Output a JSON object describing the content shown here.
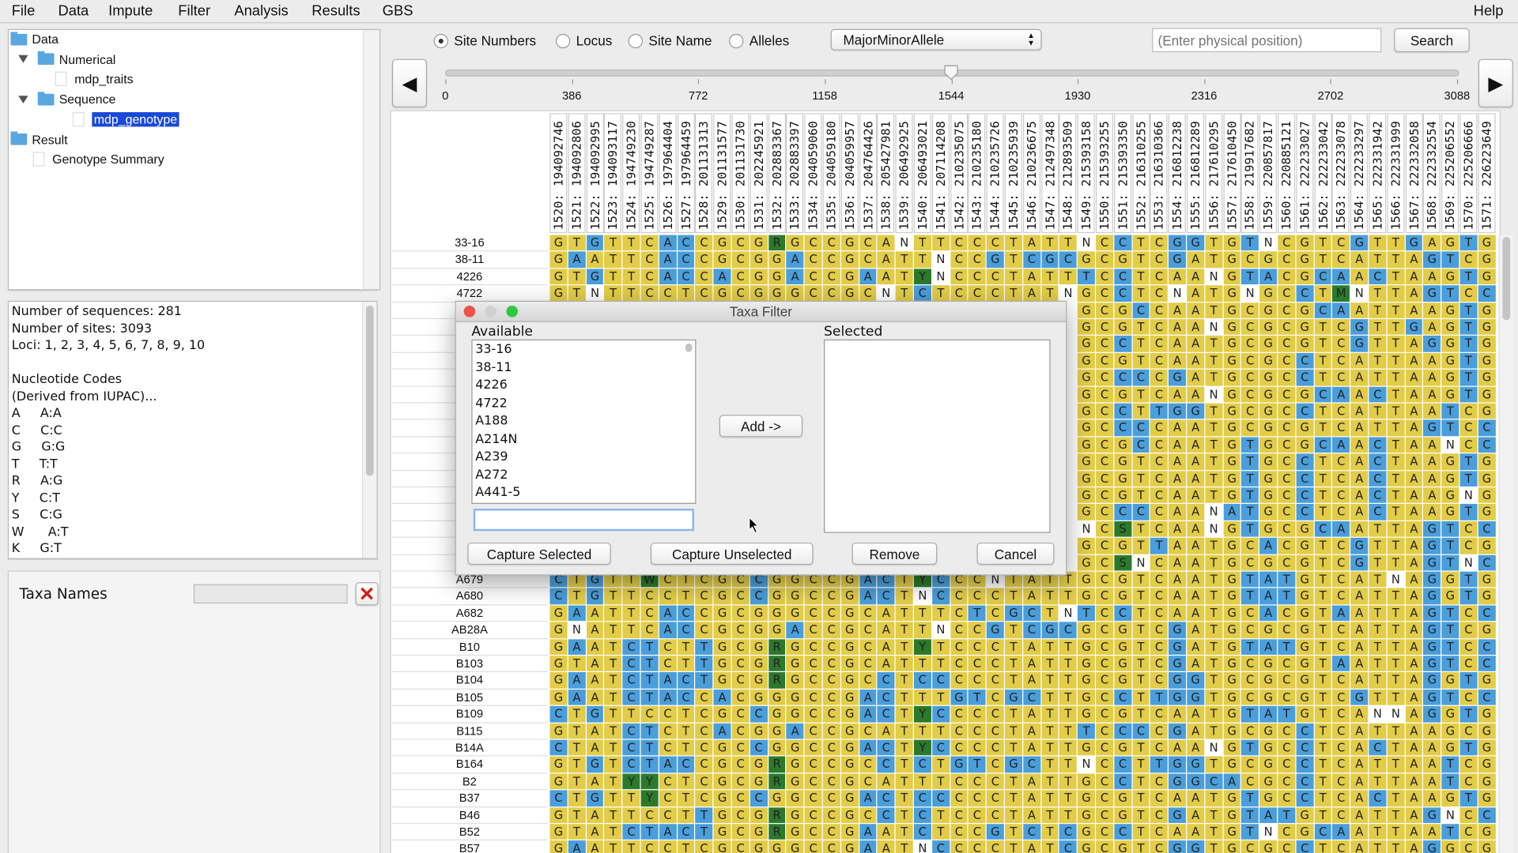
{
  "menu": {
    "items": [
      "File",
      "Data",
      "Impute",
      "Filter",
      "Analysis",
      "Results",
      "GBS"
    ],
    "help": "Help"
  },
  "tree": [
    {
      "label": "Data",
      "type": "folder",
      "expand": false,
      "selected": false
    },
    {
      "label": "Numerical",
      "type": "folder",
      "expand": true,
      "selected": false
    },
    {
      "label": "mdp_traits",
      "type": "doc",
      "expand": false,
      "selected": false
    },
    {
      "label": "Sequence",
      "type": "folder",
      "expand": true,
      "selected": false
    },
    {
      "label": "mdp_genotype",
      "type": "doc",
      "expand": false,
      "selected": true
    },
    {
      "label": "Result",
      "type": "folder",
      "expand": false,
      "selected": false
    },
    {
      "label": "Genotype Summary",
      "type": "doc",
      "expand": false,
      "selected": false
    }
  ],
  "info": [
    "Number of sequences: 281",
    "Number of sites: 3093",
    "Loci: 1, 2, 3, 4, 5, 6, 7, 8, 9, 10",
    "",
    "Nucleotide Codes",
    "(Derived from IUPAC)...",
    "A     A:A",
    "C     C:C",
    "G     G:G",
    "T     T:T",
    "R     A:G",
    "Y     C:T",
    "S     C:G",
    "W      A:T",
    "K     G:T"
  ],
  "taxa_names": {
    "label": "Taxa Names",
    "value": "",
    "clear_icon": "red-x-icon"
  },
  "view_options": {
    "radios": [
      {
        "label": "Site Numbers",
        "checked": true
      },
      {
        "label": "Locus",
        "checked": false
      },
      {
        "label": "Site Name",
        "checked": false
      },
      {
        "label": "Alleles",
        "checked": false
      }
    ],
    "dropdown": "MajorMinorAllele",
    "position_placeholder": "(Enter physical position)",
    "search": "Search"
  },
  "slider": {
    "ticks": [
      0,
      386,
      772,
      1158,
      1544,
      1930,
      2316,
      2702,
      3088
    ],
    "value": 1544,
    "max": 3088
  },
  "colors": {
    "major": "#e2cc48",
    "minor": "#4a9edb",
    "heterozygous": "#2b7a2b",
    "missing": "#ffffff"
  },
  "sites": [
    "1520: 194092746",
    "1521: 194092806",
    "1522: 194092995",
    "1523: 194093117",
    "1524: 194749230",
    "1525: 194749287",
    "1526: 197964404",
    "1527: 197964459",
    "1528: 201131313",
    "1529: 201131577",
    "1530: 201131730",
    "1531: 202245921",
    "1532: 202883367",
    "1533: 202883397",
    "1534: 204059060",
    "1535: 204059180",
    "1536: 204059957",
    "1537: 204764426",
    "1538: 205427981",
    "1539: 206492925",
    "1540: 206493021",
    "1541: 207114208",
    "1542: 210235075",
    "1543: 210235180",
    "1544: 210235726",
    "1545: 210235939",
    "1546: 210236675",
    "1547: 212497348",
    "1548: 212893509",
    "1549: 215393158",
    "1550: 215393255",
    "1551: 215393350",
    "1552: 216310255",
    "1553: 216310366",
    "1554: 216812238",
    "1555: 216812289",
    "1556: 217610295",
    "1557: 217610450",
    "1558: 219917682",
    "1559: 220857817",
    "1560: 220885121",
    "1561: 222233027",
    "1562: 222233042",
    "1563: 222233078",
    "1564: 222233297",
    "1565: 222331942",
    "1566: 222331999",
    "1567: 222332058",
    "1568: 222332554",
    "1569: 225206552",
    "1570: 225206666",
    "1571: 226223649"
  ],
  "rows": [
    {
      "taxon": "33-16",
      "seq": "GTGTTCACCGCGRGCCGCANTTCCCTATTNCCTCGGTGTNCGTCGTTGAGTG"
    },
    {
      "taxon": "38-11",
      "seq": "GAATTCACCGCGGACCGCATTNCCGTCGCGCGTCGATGCGCGTCATTAGTCG"
    },
    {
      "taxon": "4226",
      "seq": "GTGTTCACCACGGACCGAATYNCCCTATTTCCTCAANGTACGCAACTAAGTG"
    },
    {
      "taxon": "4722",
      "seq": "GTNTTCCTCGCGGGCCGCNTCTCCCTATNGCCTCNATGNGCCTMNTTAGTCC"
    },
    {
      "taxon": "",
      "seq": "                             GCGCCAATGCGCGCAATTAAGTG"
    },
    {
      "taxon": "",
      "seq": "                             GCGTCAANGCGCGTCGTTGAGTG"
    },
    {
      "taxon": "",
      "seq": "                             GCCTCAATGCGCGTCGTTAGGTG"
    },
    {
      "taxon": "",
      "seq": "                             GCGTCAATGCGCCTCATTAAGTG"
    },
    {
      "taxon": "",
      "seq": "                             GCCCCGATGCGCCTCATTAAGTG"
    },
    {
      "taxon": "",
      "seq": "                             GCGTCAANGCGCGCAACTAAGTG"
    },
    {
      "taxon": "",
      "seq": "                             GCCTTGGTGCGCCTCATTAATCG"
    },
    {
      "taxon": "",
      "seq": "                             GCCCCAATGCGCGTCATTAGTCC"
    },
    {
      "taxon": "",
      "seq": "                             GCGCCAATGTGCGCAACTAANCC"
    },
    {
      "taxon": "",
      "seq": "                             GCGTCAATGTGCCTCACTAAGTG"
    },
    {
      "taxon": "",
      "seq": "                             GCGTCAATGTGCCTCACTAAGTG"
    },
    {
      "taxon": "",
      "seq": "                             GCGTCAATGTGCCTCACTAAGNG"
    },
    {
      "taxon": "",
      "seq": "                             GCCCCAANATGCCTCACTAAGTG"
    },
    {
      "taxon": "",
      "seq": "                             NCSTCAANGTGCGCAATTAGTCC"
    },
    {
      "taxon": "",
      "seq": "                             GCGTTAATGCACGTCGTTAGTCG"
    },
    {
      "taxon": "",
      "seq": "                             GCSNCAATGCGCGTCGTTAGTNC"
    },
    {
      "taxon": "A679",
      "seq": "CTGTTWCTCGCCGGCCGACTYCCCNTATTGCGTCAATGTATGTCATNAGGTG"
    },
    {
      "taxon": "A680",
      "seq": "CTGTTCCTCGCCGGCCGACTNCCCCTATTGCGTCAATGTATGTCATTAGGTG"
    },
    {
      "taxon": "A682",
      "seq": "GAATTCACCGCGGGCCGCATTTCTCGCTNTCCTCAATGCACGTAATTAGTCC"
    },
    {
      "taxon": "AB28A",
      "seq": "GNATTCACCGCGGACCGCATTNCCGTCGCGCGTCGATGCGCGTCATTAGTCG"
    },
    {
      "taxon": "B10",
      "seq": "GAATCTCTTGCGRGCCGCATYTCCCTATTGCGTCGATGTATGTCATTAGTCC"
    },
    {
      "taxon": "B103",
      "seq": "GTATCTCTTGCGRGCCGCATTTCCCTATTGCGTCGATGCGCGTAATTAGTCC"
    },
    {
      "taxon": "B104",
      "seq": "GAATCTACTGCGRGCCGCCTCCCCCTATTGCGTCGGTGCGCGTCATTAGGTG"
    },
    {
      "taxon": "B105",
      "seq": "GAATCTACCACGGGCCGACTTTGTCGCTTGCCTTGGTGCGCGTCGTTAGTCC"
    },
    {
      "taxon": "B109",
      "seq": "CTGTTCCTCGCCGGCCGACTYCCCCTATTGCGTCAATGTATGTCANNAGGTG"
    },
    {
      "taxon": "B115",
      "seq": "GTATCTCTCACGGACCGCATTTCCCTATTTCCCCGATGCGCCTCATTAAGCG"
    },
    {
      "taxon": "B14A",
      "seq": "CTATCTCTCGCCGGCCGACTYCCCCTATTGCGTCAANGTGCCTCACTAAGTG"
    },
    {
      "taxon": "B164",
      "seq": "GTGTCTACCGCGRGCCGCCTCTGTCGCTTNCCTTGGTGCGCCTCATTAATCG"
    },
    {
      "taxon": "B2",
      "seq": "GTATYYCTCGCGRGCCGCATTTCCCTATTGCCTCGGCACGCCTCATTAATCG"
    },
    {
      "taxon": "B37",
      "seq": "CTGTTYCTCGCCGGCCGACTCCCCCTATTGCGTCAATGTGCCTCACTAAGTG"
    },
    {
      "taxon": "B46",
      "seq": "GTATTCCTTGCGRGCCGCCTCTCCCTATTGCGTCGATGTATGTCATTAGNCC"
    },
    {
      "taxon": "B52",
      "seq": "GTATCTACTGCGRGCCGAATCTCCGTCTCGCCTCAATGTNCGCAATTAATCG"
    },
    {
      "taxon": "B57",
      "seq": "GAATTCCTCGCGGGCCGAATNCCCCTATCGCGTCGGTGCGCCTCATTAGGCG"
    }
  ],
  "dialog": {
    "title": "Taxa Filter",
    "available_label": "Available",
    "selected_label": "Selected",
    "available": [
      "33-16",
      "38-11",
      "4226",
      "4722",
      "A188",
      "A214N",
      "A239",
      "A272",
      "A441-5"
    ],
    "selected": [],
    "filter_value": "",
    "add": "Add ->",
    "capture_selected": "Capture Selected",
    "capture_unselected": "Capture Unselected",
    "remove": "Remove",
    "cancel": "Cancel"
  }
}
